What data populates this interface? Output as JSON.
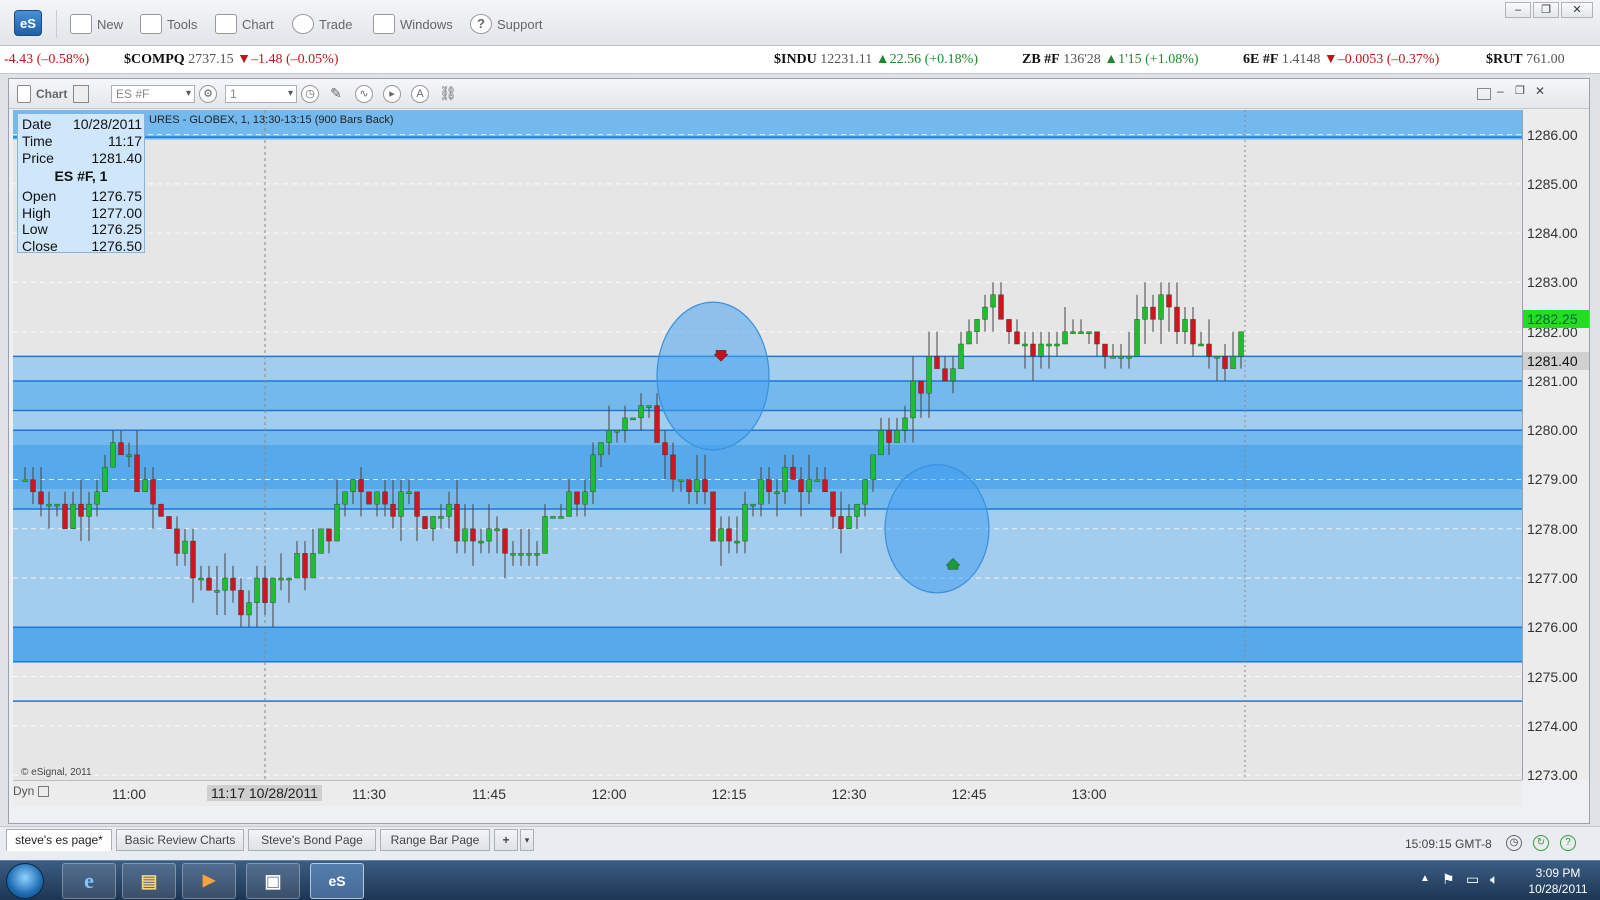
{
  "app": {
    "logo": "eS"
  },
  "menu": {
    "items": [
      {
        "label": "New",
        "icon": "new-window-icon"
      },
      {
        "label": "Tools",
        "icon": "tools-icon"
      },
      {
        "label": "Chart",
        "icon": "chart-icon"
      },
      {
        "label": "Trade",
        "icon": "trade-icon"
      },
      {
        "label": "Windows",
        "icon": "windows-icon"
      },
      {
        "label": "Support",
        "icon": "help-icon"
      }
    ]
  },
  "ticker": [
    {
      "symbol": "",
      "price": "",
      "change": "-4.43 (–0.58%)",
      "dir": "down"
    },
    {
      "symbol": "$COMPQ",
      "price": "2737.15",
      "change": "▼–1.48 (–0.05%)",
      "dir": "down"
    },
    {
      "symbol": "$INDU",
      "price": "12231.11",
      "change": "▲22.56 (+0.18%)",
      "dir": "up"
    },
    {
      "symbol": "ZB #F",
      "price": "136'28",
      "change": "▲1'15 (+1.08%)",
      "dir": "up"
    },
    {
      "symbol": "6E #F",
      "price": "1.4148",
      "change": "▼–0.0053 (–0.37%)",
      "dir": "down"
    },
    {
      "symbol": "$RUT",
      "price": "761.00",
      "change": "",
      "dir": "up"
    }
  ],
  "chart_window": {
    "label": "Chart",
    "symbol_value": "ES #F",
    "interval_value": "1",
    "title": "URES - GLOBEX, 1, 13:30-13:15 (900 Bars Back)",
    "copyright": "© eSignal, 2011",
    "dyn_label": "Dyn"
  },
  "infobox": {
    "date_label": "Date",
    "date": "10/28/2011",
    "time_label": "Time",
    "time": "11:17",
    "price_label": "Price",
    "price": "1281.40",
    "symbol": "ES #F, 1",
    "open_label": "Open",
    "open": "1276.75",
    "high_label": "High",
    "high": "1277.00",
    "low_label": "Low",
    "low": "1276.25",
    "close_label": "Close",
    "close": "1276.50"
  },
  "chart_data": {
    "type": "candlestick",
    "y_range": [
      1272.9,
      1286.5
    ],
    "y_ticks": [
      "1286.00",
      "1285.00",
      "1284.00",
      "1283.00",
      "1282.00",
      "1281.00",
      "1280.00",
      "1279.00",
      "1278.00",
      "1277.00",
      "1276.00",
      "1275.00",
      "1274.00",
      "1273.00"
    ],
    "x_ticks": [
      {
        "label": "11:00",
        "t": 13
      },
      {
        "label": "11:30",
        "t": 43
      },
      {
        "label": "11:45",
        "t": 58
      },
      {
        "label": "12:00",
        "t": 73
      },
      {
        "label": "12:15",
        "t": 88
      },
      {
        "label": "12:30",
        "t": 103
      },
      {
        "label": "12:45",
        "t": 118
      },
      {
        "label": "13:00",
        "t": 133
      }
    ],
    "cursor_x_label": "11:17 10/28/2011",
    "cursor_t": 30,
    "cursor_price": "1281.40",
    "last_price": "1282.25",
    "zones": [
      {
        "from": 1275.3,
        "to": 1276.0,
        "shade": "dark"
      },
      {
        "from": 1276.0,
        "to": 1278.4,
        "shade": "light"
      },
      {
        "from": 1278.4,
        "to": 1278.8,
        "shade": "mid"
      },
      {
        "from": 1278.8,
        "to": 1279.7,
        "shade": "dark"
      },
      {
        "from": 1279.7,
        "to": 1280.0,
        "shade": "mid"
      },
      {
        "from": 1280.0,
        "to": 1280.4,
        "shade": "light"
      },
      {
        "from": 1280.4,
        "to": 1281.0,
        "shade": "mid"
      },
      {
        "from": 1281.0,
        "to": 1281.5,
        "shade": "light"
      },
      {
        "from": 1285.9,
        "to": 1286.5,
        "shade": "mid"
      }
    ],
    "level_lines": [
      1274.5,
      1275.3,
      1276.0,
      1278.4,
      1280.0,
      1280.4,
      1281.0,
      1281.5,
      1285.95
    ],
    "circles": [
      {
        "t": 86,
        "price": 1281.1,
        "rx_bars": 7,
        "ry_price": 1.5
      },
      {
        "t": 114,
        "price": 1278.0,
        "rx_bars": 6.5,
        "ry_price": 1.3
      }
    ],
    "arrows": [
      {
        "t": 87,
        "price": 1281.5,
        "dir": "down",
        "color": "#c0141c"
      },
      {
        "t": 116,
        "price": 1277.3,
        "dir": "up",
        "color": "#1a9a3a"
      }
    ],
    "colors": {
      "up": "#19c22a",
      "down": "#d4141c",
      "last_price_bg": "#22dd22"
    }
  },
  "tabs": [
    "steve's es page*",
    "Basic Review Charts",
    "Steve's Bond Page",
    "Range Bar Page"
  ],
  "add_tab": "+",
  "status": {
    "clock": "15:09:15 GMT-8"
  },
  "taskbar": {
    "time": "3:09 PM",
    "date": "10/28/2011",
    "apps": [
      {
        "name": "internet-explorer-icon",
        "glyph": "e"
      },
      {
        "name": "file-explorer-icon",
        "glyph": "▤"
      },
      {
        "name": "media-player-icon",
        "glyph": "▶"
      },
      {
        "name": "remote-desktop-icon",
        "glyph": "▣"
      },
      {
        "name": "esignal-taskbar-icon",
        "glyph": "eS"
      }
    ]
  }
}
